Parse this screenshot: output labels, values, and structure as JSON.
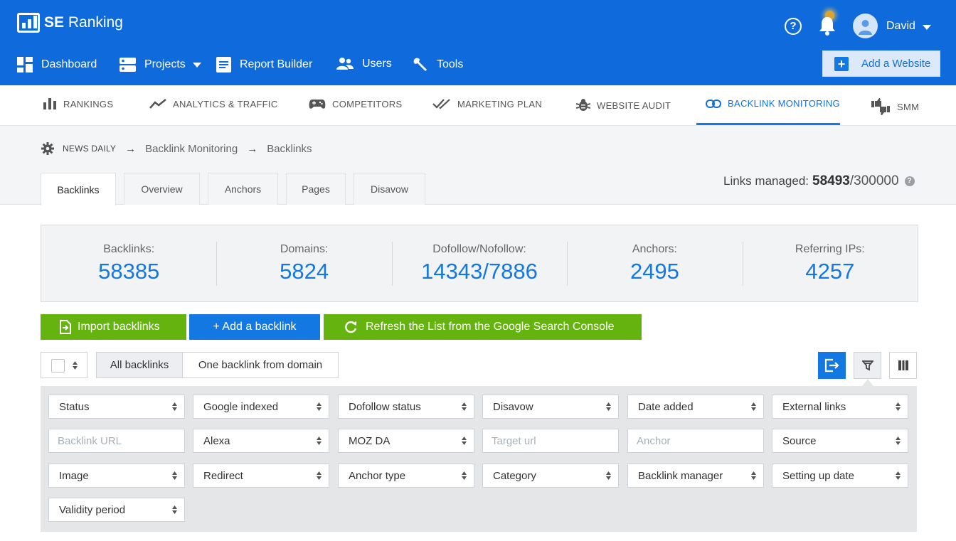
{
  "header": {
    "brand": "SE Ranking",
    "user_name": "David",
    "add_website_label": "Add a Website",
    "main_nav": [
      {
        "label": "Dashboard"
      },
      {
        "label": "Projects"
      },
      {
        "label": "Report Builder"
      },
      {
        "label": "Users"
      },
      {
        "label": "Tools"
      }
    ]
  },
  "subnav": {
    "items": [
      {
        "label": "RANKINGS",
        "icon": "bar-chart-icon"
      },
      {
        "label": "ANALYTICS & TRAFFIC",
        "icon": "trend-line-icon"
      },
      {
        "label": "COMPETITORS",
        "icon": "gamepad-icon"
      },
      {
        "label": "MARKETING PLAN",
        "icon": "double-check-icon"
      },
      {
        "label": "WEBSITE AUDIT",
        "icon": "bug-icon"
      },
      {
        "label": "BACKLINK MONITORING",
        "icon": "link-icon",
        "active": true
      },
      {
        "label": "SMM",
        "icon": "thumbs-icon"
      }
    ]
  },
  "breadcrumb": {
    "project": "NEWS DAILY",
    "section": "Backlink Monitoring",
    "page": "Backlinks"
  },
  "tabs": [
    {
      "label": "Backlinks",
      "active": true
    },
    {
      "label": "Overview"
    },
    {
      "label": "Anchors"
    },
    {
      "label": "Pages"
    },
    {
      "label": "Disavow"
    }
  ],
  "links_managed": {
    "label": "Links managed:",
    "count": "58493",
    "limit": "/300000"
  },
  "stats": [
    {
      "label": "Backlinks:",
      "value": "58385"
    },
    {
      "label": "Domains:",
      "value": "5824"
    },
    {
      "label": "Dofollow/Nofollow:",
      "value": "14343/7886"
    },
    {
      "label": "Anchors:",
      "value": "2495"
    },
    {
      "label": "Referring IPs:",
      "value": "4257"
    }
  ],
  "actions": {
    "import_label": "Import backlinks",
    "add_label": "+ Add a backlink",
    "refresh_label": "Refresh the List from the Google Search Console"
  },
  "view_toggle": {
    "all_label": "All backlinks",
    "one_label": "One backlink from domain"
  },
  "filters": {
    "row1": [
      "Status",
      "Google indexed",
      "Dofollow status",
      "Disavow",
      "Date added",
      "External links"
    ],
    "row2": [
      {
        "text": "Backlink URL",
        "placeholder": true
      },
      {
        "text": "Alexa"
      },
      {
        "text": "MOZ DA"
      },
      {
        "text": "Target url",
        "placeholder": true
      },
      {
        "text": "Anchor",
        "placeholder": true
      },
      {
        "text": "Source"
      }
    ],
    "row3": [
      "Image",
      "Redirect",
      "Anchor type",
      "Category",
      "Backlink manager",
      "Setting up date"
    ],
    "row4": [
      "Validity period"
    ]
  },
  "colors": {
    "brand_blue": "#0f6bdc",
    "accent_blue": "#1478e3",
    "green": "#65b30f"
  }
}
